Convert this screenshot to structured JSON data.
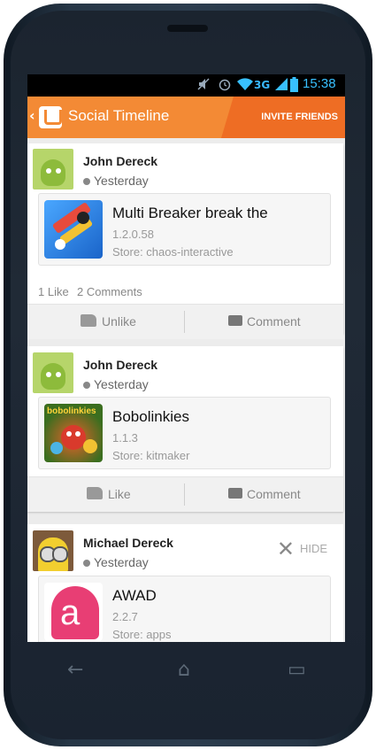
{
  "status_bar": {
    "network": "3G",
    "time": "15:38"
  },
  "action_bar": {
    "back": "‹",
    "title": "Social Timeline",
    "invite_label": "INVITE FRIENDS"
  },
  "feed": [
    {
      "user": "John Dereck",
      "time": "Yesterday",
      "avatar_icon": "android-avatar",
      "app": {
        "name": "Multi Breaker break the",
        "version": "1.2.0.58",
        "store": "Store: chaos-interactive"
      },
      "likes": "1 Like",
      "comments": "2 Comments",
      "like_label": "Unlike",
      "comment_label": "Comment"
    },
    {
      "user": "John Dereck",
      "time": "Yesterday",
      "avatar_icon": "android-avatar",
      "app": {
        "name": "Bobolinkies",
        "icon_text": "bobolinkies",
        "version": "1.1.3",
        "store": "Store: kitmaker"
      },
      "like_label": "Like",
      "comment_label": "Comment"
    },
    {
      "user": "Michael Dereck",
      "time": "Yesterday",
      "avatar_icon": "minion-avatar",
      "hide_label": "HIDE",
      "app": {
        "name": "AWAD",
        "icon_text": "a",
        "version": "2.2.7",
        "store": "Store: apps"
      }
    }
  ],
  "nav": {
    "back": "←",
    "home": "⌂",
    "recents": "▭"
  },
  "colors": {
    "accent": "#f38a35",
    "accent_dark": "#ee6d24",
    "status_blue": "#38c0ff"
  }
}
